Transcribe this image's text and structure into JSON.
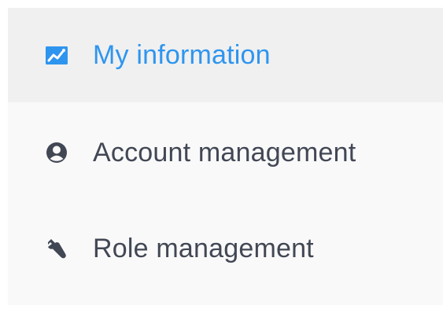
{
  "sidebar": {
    "items": [
      {
        "label": "My information",
        "icon": "chart-icon",
        "active": true
      },
      {
        "label": "Account management",
        "icon": "user-circle-icon",
        "active": false
      },
      {
        "label": "Role management",
        "icon": "wrench-icon",
        "active": false
      }
    ]
  },
  "colors": {
    "active_text": "#2e95ef",
    "inactive_text": "#424754",
    "active_background": "#f0f0f0",
    "menu_background": "#f9f9fa"
  }
}
